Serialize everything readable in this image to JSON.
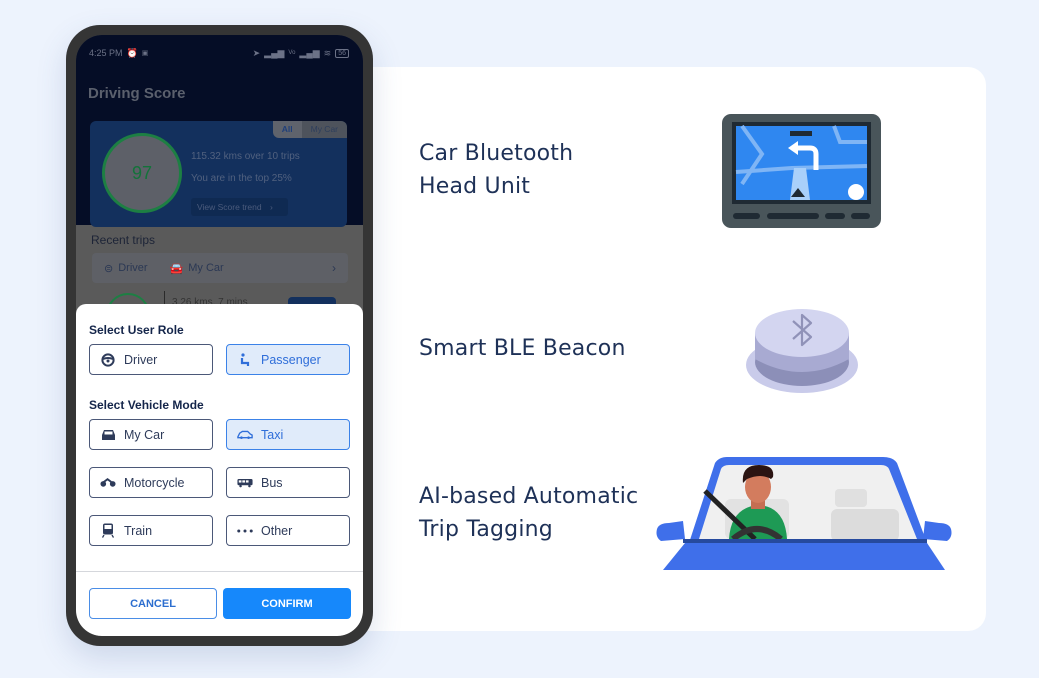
{
  "features": [
    {
      "title_lines": [
        "Car Bluetooth",
        "Head Unit"
      ],
      "icon": "car-head-unit-illustration"
    },
    {
      "title_lines": [
        "Smart BLE Beacon"
      ],
      "icon": "ble-beacon-illustration"
    },
    {
      "title_lines": [
        "AI-based Automatic",
        "Trip Tagging"
      ],
      "icon": "driver-in-car-illustration"
    }
  ],
  "phone": {
    "statusbar": {
      "time": "4:25 PM",
      "battery": "56"
    },
    "app_title": "Driving Score",
    "score_card": {
      "tabs": [
        "All",
        "My Car"
      ],
      "active_tab": "All",
      "score": "97",
      "distance_line": "115.32 kms over 10 trips",
      "rank_line": "You are in the top 25%",
      "trend_button": "View Score trend"
    },
    "recent_trips": {
      "title": "Recent trips",
      "role": "Driver",
      "vehicle": "My Car",
      "peek_trip_text": "3.26 kms, 7 mins"
    },
    "sheet": {
      "role_label": "Select User Role",
      "roles": [
        {
          "label": "Driver",
          "icon": "steering-wheel-icon",
          "selected": false
        },
        {
          "label": "Passenger",
          "icon": "passenger-seat-icon",
          "selected": true
        }
      ],
      "vehicle_label": "Select Vehicle Mode",
      "vehicles": [
        {
          "label": "My Car",
          "icon": "car-icon",
          "selected": false
        },
        {
          "label": "Taxi",
          "icon": "taxi-icon",
          "selected": true
        },
        {
          "label": "Motorcycle",
          "icon": "motorcycle-icon",
          "selected": false
        },
        {
          "label": "Bus",
          "icon": "bus-icon",
          "selected": false
        },
        {
          "label": "Train",
          "icon": "train-icon",
          "selected": false
        },
        {
          "label": "Other",
          "icon": "more-dots-icon",
          "selected": false
        }
      ],
      "cancel_label": "CANCEL",
      "confirm_label": "CONFIRM"
    }
  },
  "colors": {
    "accent": "#1688fb",
    "selected_bg": "#e0ebfa",
    "title_text": "#1e3157",
    "car_blue": "#3f6fea"
  }
}
